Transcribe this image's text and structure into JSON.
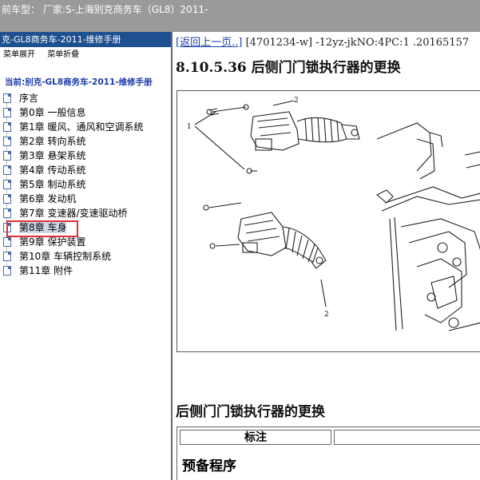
{
  "topbar": {
    "title": "前车型： 厂家:S-上海别克商务车（GL8）2011-"
  },
  "left_panel": {
    "header": "克-GL8商务车-2011-维修手册",
    "toolbar": {
      "expand": "菜单展开",
      "collapse": "菜单折叠"
    },
    "current": "当前:别克-GL8商务车-2011-维修手册",
    "tree": [
      {
        "label": "序言"
      },
      {
        "label": "第0章 一般信息"
      },
      {
        "label": "第1章 暖风、通风和空调系统"
      },
      {
        "label": "第2章 转向系统"
      },
      {
        "label": "第3章 悬架系统"
      },
      {
        "label": "第4章 传动系统"
      },
      {
        "label": "第5章 制动系统"
      },
      {
        "label": "第6章 发动机"
      },
      {
        "label": "第7章 变速器/变速驱动桥"
      },
      {
        "label": "第8章 车身",
        "selected": true
      },
      {
        "label": "第9章 保护装置"
      },
      {
        "label": "第10章 车辆控制系统"
      },
      {
        "label": "第11章 附件"
      }
    ]
  },
  "content": {
    "back_link": "[返回上一页..]",
    "doc_code": "[4701234-w] -12yz-jkNO:4PC:1 .20165157",
    "title": "8.10.5.36 后侧门门锁执行器的更换",
    "figure": {
      "callout_1": "1",
      "callout_2": "2"
    },
    "subtitle": "后侧门门锁执行器的更换",
    "table_header": "标注",
    "prep": "预备程序"
  },
  "colors": {
    "topbar": "#9a9a9a",
    "panel_header": "#1e4f8f",
    "link": "#1a3fb0",
    "highlight": "#e0303a"
  }
}
